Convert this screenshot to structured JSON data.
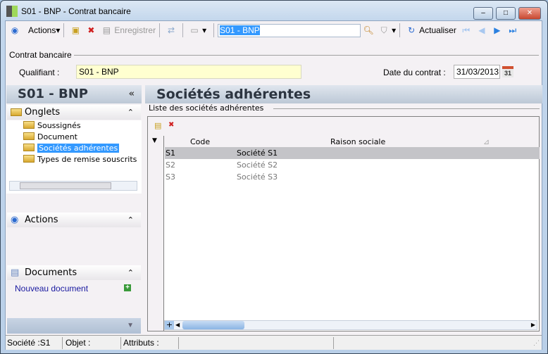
{
  "window": {
    "title": "S01 - BNP -  Contrat bancaire",
    "minimize": "–",
    "maximize": "□",
    "close": "✕"
  },
  "toolbar": {
    "actions_label": "Actions",
    "save_label": "Enregistrer",
    "search_value": "S01 - BNP",
    "refresh_label": "Actualiser"
  },
  "form": {
    "group_title": "Contrat bancaire",
    "qualifiant_label": "Qualifiant :",
    "qualifiant_value": "S01 - BNP",
    "date_label": "Date du contrat :",
    "date_value": "31/03/2013",
    "calendar_day": "31"
  },
  "sidebar": {
    "title": "S01 - BNP",
    "collapse": "«",
    "onglets": {
      "title": "Onglets",
      "items": [
        {
          "label": "Soussignés"
        },
        {
          "label": "Document"
        },
        {
          "label": "Sociétés adhérentes"
        },
        {
          "label": "Types de remise souscrits"
        }
      ]
    },
    "actions": {
      "title": "Actions"
    },
    "documents": {
      "title": "Documents",
      "new_label": "Nouveau document"
    }
  },
  "main": {
    "title": "Sociétés adhérentes",
    "list_title": "Liste des sociétés adhérentes",
    "columns": [
      "Code",
      "Raison sociale"
    ],
    "rows": [
      {
        "code": "S1",
        "name": "Société S1"
      },
      {
        "code": "S2",
        "name": "Société S2"
      },
      {
        "code": "S3",
        "name": "Société S3"
      }
    ],
    "add_row": "+"
  },
  "status": {
    "societe": "Société :S1",
    "objet": "Objet :",
    "attributs": "Attributs :"
  },
  "colors": {
    "selection": "#3399ff",
    "selected_row": "#c4c4c8",
    "qualifiant_bg": "#ffffd0",
    "link": "#1a1aa0"
  }
}
